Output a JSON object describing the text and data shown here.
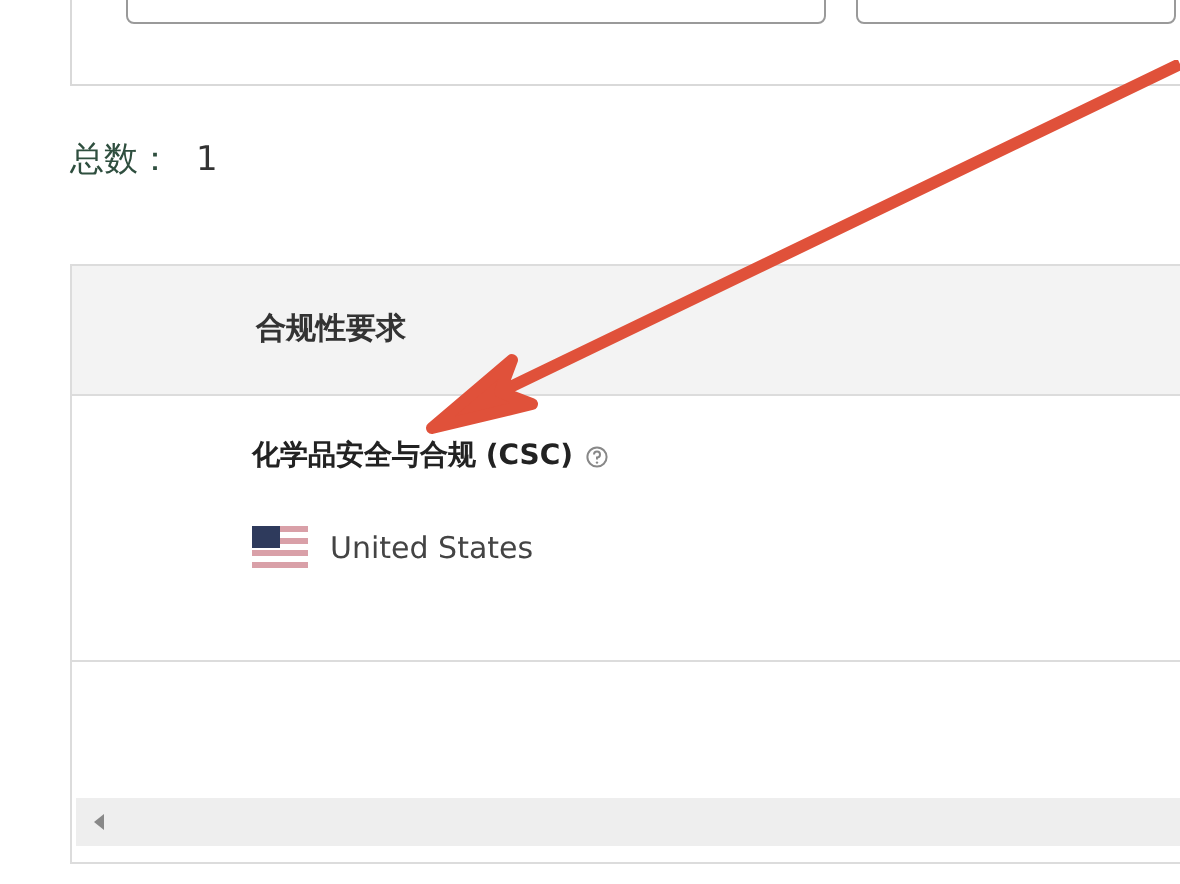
{
  "filter_fields": [
    {
      "kind": "input"
    },
    {
      "kind": "input"
    }
  ],
  "total": {
    "label": "总数：",
    "value": "1"
  },
  "table": {
    "columns": [
      "合规性要求"
    ],
    "rows": [
      {
        "requirement": "化学品安全与合规 (CSC)",
        "country": "United States"
      }
    ]
  }
}
